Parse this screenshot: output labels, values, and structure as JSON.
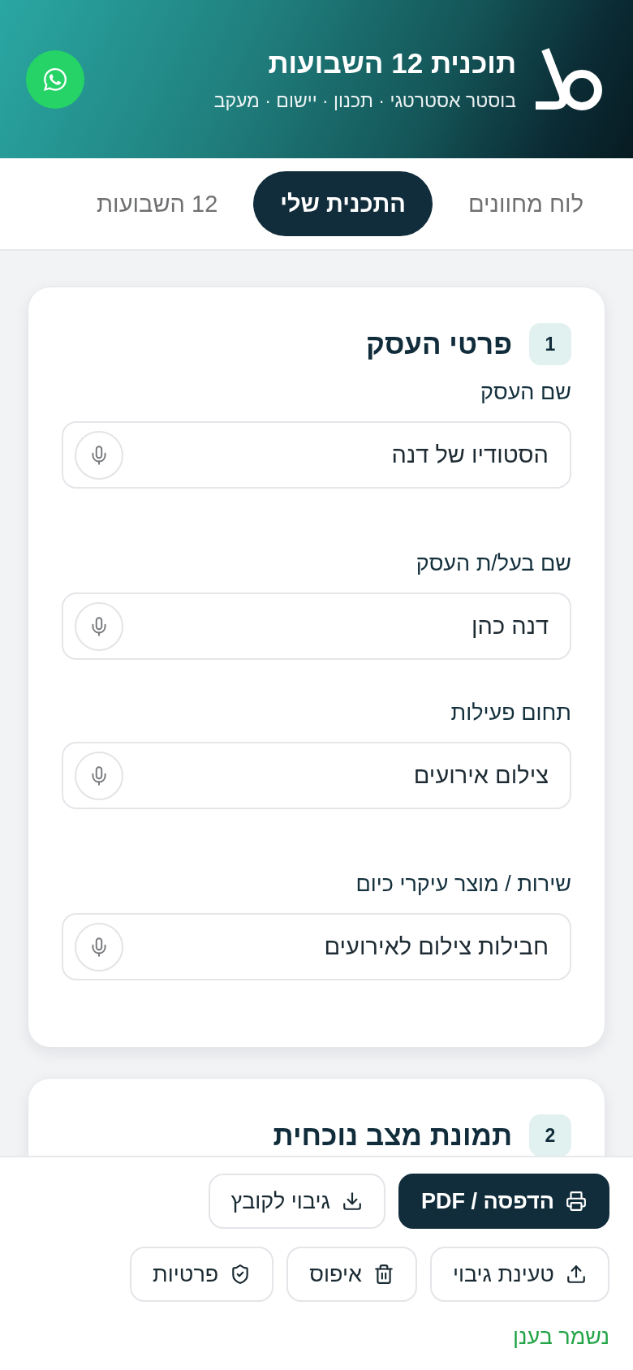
{
  "header": {
    "title": "תוכנית 12 השבועות",
    "subtitle": "בוסטר אסטרטגי · תכנון · יישום · מעקב"
  },
  "tabs": [
    {
      "label": "לוח מחוונים",
      "selected": false
    },
    {
      "label": "התכנית שלי",
      "selected": true
    },
    {
      "label": "12 השבועות",
      "selected": false
    }
  ],
  "sections": [
    {
      "number": "1",
      "title": "פרטי העסק",
      "fields": [
        {
          "label": "שם העסק",
          "value": "הסטודיו של דנה"
        },
        {
          "label": "שם בעל/ת העסק",
          "value": "דנה כהן"
        },
        {
          "label": "תחום פעילות",
          "value": "צילום אירועים"
        },
        {
          "label": "שירות / מוצר עיקרי כיום",
          "value": "חבילות צילום לאירועים"
        }
      ]
    },
    {
      "number": "2",
      "title": "תמונת מצב נוכחית"
    }
  ],
  "action_rows": [
    {
      "buttons": [
        {
          "kind": "print",
          "label": "הדפסה / PDF"
        },
        {
          "kind": "export",
          "label": "גיבוי לקובץ"
        }
      ]
    },
    {
      "buttons": [
        {
          "kind": "import",
          "label": "טעינת גיבוי"
        },
        {
          "kind": "reset",
          "label": "איפוס"
        },
        {
          "kind": "privacy",
          "label": "פרטיות"
        }
      ]
    }
  ],
  "status": "נשמר בענן"
}
